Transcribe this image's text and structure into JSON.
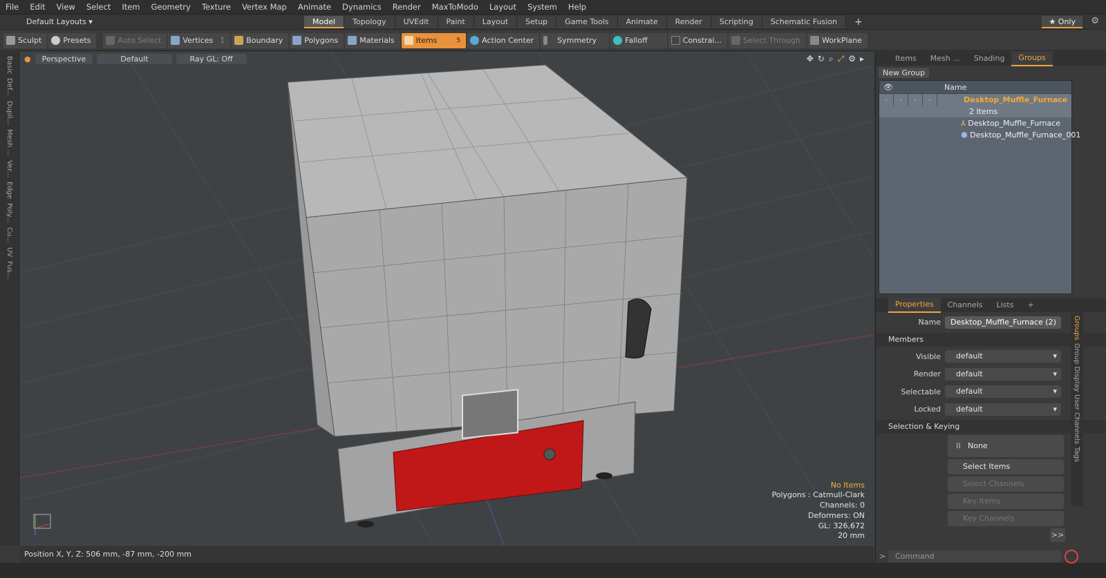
{
  "menu": [
    "File",
    "Edit",
    "View",
    "Select",
    "Item",
    "Geometry",
    "Texture",
    "Vertex Map",
    "Animate",
    "Dynamics",
    "Render",
    "MaxToModo",
    "Layout",
    "System",
    "Help"
  ],
  "layout": {
    "selector": "Default Layouts ▾",
    "tabs": [
      "Model",
      "Topology",
      "UVEdit",
      "Paint",
      "Layout",
      "Setup",
      "Game Tools",
      "Animate",
      "Render",
      "Scripting",
      "Schematic Fusion"
    ],
    "active_tab": "Model",
    "only": "★  Only"
  },
  "toolbar": {
    "sculpt": "Sculpt",
    "presets": "Presets",
    "auto_select": "Auto Select",
    "vertices": "Vertices",
    "vertices_count": "1",
    "boundary": "Boundary",
    "polygons": "Polygons",
    "materials": "Materials",
    "items": "Items",
    "items_count": "5",
    "action_center": "Action Center",
    "symmetry": "Symmetry",
    "falloff": "Falloff",
    "constraints": "Constrai...",
    "select_through": "Select Through",
    "workplane": "WorkPlane"
  },
  "left_tabs": [
    "Basic",
    "Def...",
    "Dupli...",
    "Mesh ...",
    "Ver...",
    "Edge",
    "Poly...",
    "Cu...",
    "UV",
    "Fus..."
  ],
  "viewport": {
    "view": "Perspective",
    "shading": "Default",
    "raygl": "Ray GL: Off",
    "info": {
      "selection": "No Items",
      "polygons": "Polygons : Catmull-Clark",
      "channels": "Channels: 0",
      "deformers": "Deformers: ON",
      "gl": "GL: 326,672",
      "scale": "20 mm"
    }
  },
  "status": {
    "position": "Position X, Y, Z:  506 mm, -87 mm, -200 mm"
  },
  "right_panel": {
    "tabs": [
      "Items",
      "Mesh ...",
      "Shading",
      "Groups"
    ],
    "active_tab": "Groups",
    "new_group": "New Group",
    "name_col": "Name",
    "group": {
      "name": "Desktop_Muffle_Furnace",
      "count": "2 Items",
      "children": [
        "Desktop_Muffle_Furnace",
        "Desktop_Muffle_Furnace_001"
      ]
    },
    "prop_tabs": [
      "Properties",
      "Channels",
      "Lists",
      "+"
    ],
    "active_prop_tab": "Properties",
    "name_label": "Name",
    "name_value": "Desktop_Muffle_Furnace (2)",
    "members": "Members",
    "fields": [
      {
        "label": "Visible",
        "value": "default"
      },
      {
        "label": "Render",
        "value": "default"
      },
      {
        "label": "Selectable",
        "value": "default"
      },
      {
        "label": "Locked",
        "value": "default"
      }
    ],
    "selection_keying": "Selection & Keying",
    "none": "None",
    "buttons": [
      "Select Items",
      "Select Channels",
      "Key Items",
      "Key Channels"
    ],
    "more": ">>",
    "side_tabs": [
      "Groups",
      "Group Display",
      "User Channels",
      "Tags"
    ]
  },
  "command": {
    "placeholder": "Command"
  },
  "colors": {
    "accent": "#e9923b",
    "viewport_bg": "#3f4245",
    "furnace_panel": "#c01818",
    "mesh": "#bdbdbd"
  }
}
